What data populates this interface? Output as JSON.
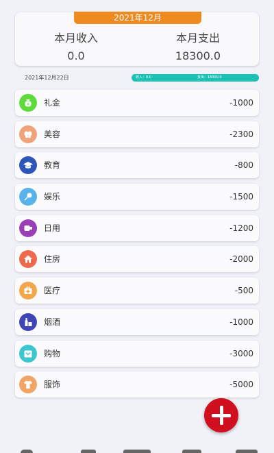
{
  "summary": {
    "month": "2021年12月",
    "income_label": "本月收入",
    "income_value": "0.0",
    "expense_label": "本月支出",
    "expense_value": "18300.0"
  },
  "day": {
    "date": "2021年12月22日",
    "income_text": "收入：0.0",
    "expense_text": "支出：18300.0"
  },
  "items": [
    {
      "label": "礼金",
      "amount": "-1000",
      "icon": "money-bag-icon",
      "color": "#5ddb3a"
    },
    {
      "label": "美容",
      "amount": "-2300",
      "icon": "butterfly-icon",
      "color": "#f0a27a"
    },
    {
      "label": "教育",
      "amount": "-800",
      "icon": "graduation-cap-icon",
      "color": "#2e55b8"
    },
    {
      "label": "娱乐",
      "amount": "-1500",
      "icon": "microphone-icon",
      "color": "#58b3ea"
    },
    {
      "label": "日用",
      "amount": "-1200",
      "icon": "tissue-icon",
      "color": "#9b3fb7"
    },
    {
      "label": "住房",
      "amount": "-2000",
      "icon": "house-icon",
      "color": "#ee6a4c"
    },
    {
      "label": "医疗",
      "amount": "-500",
      "icon": "medical-kit-icon",
      "color": "#f2a84a"
    },
    {
      "label": "烟酒",
      "amount": "-1000",
      "icon": "bottle-icon",
      "color": "#3f45b4"
    },
    {
      "label": "购物",
      "amount": "-3000",
      "icon": "shopping-bag-icon",
      "color": "#3ec6cf"
    },
    {
      "label": "服饰",
      "amount": "-5000",
      "icon": "shirt-icon",
      "color": "#f0a564"
    }
  ]
}
